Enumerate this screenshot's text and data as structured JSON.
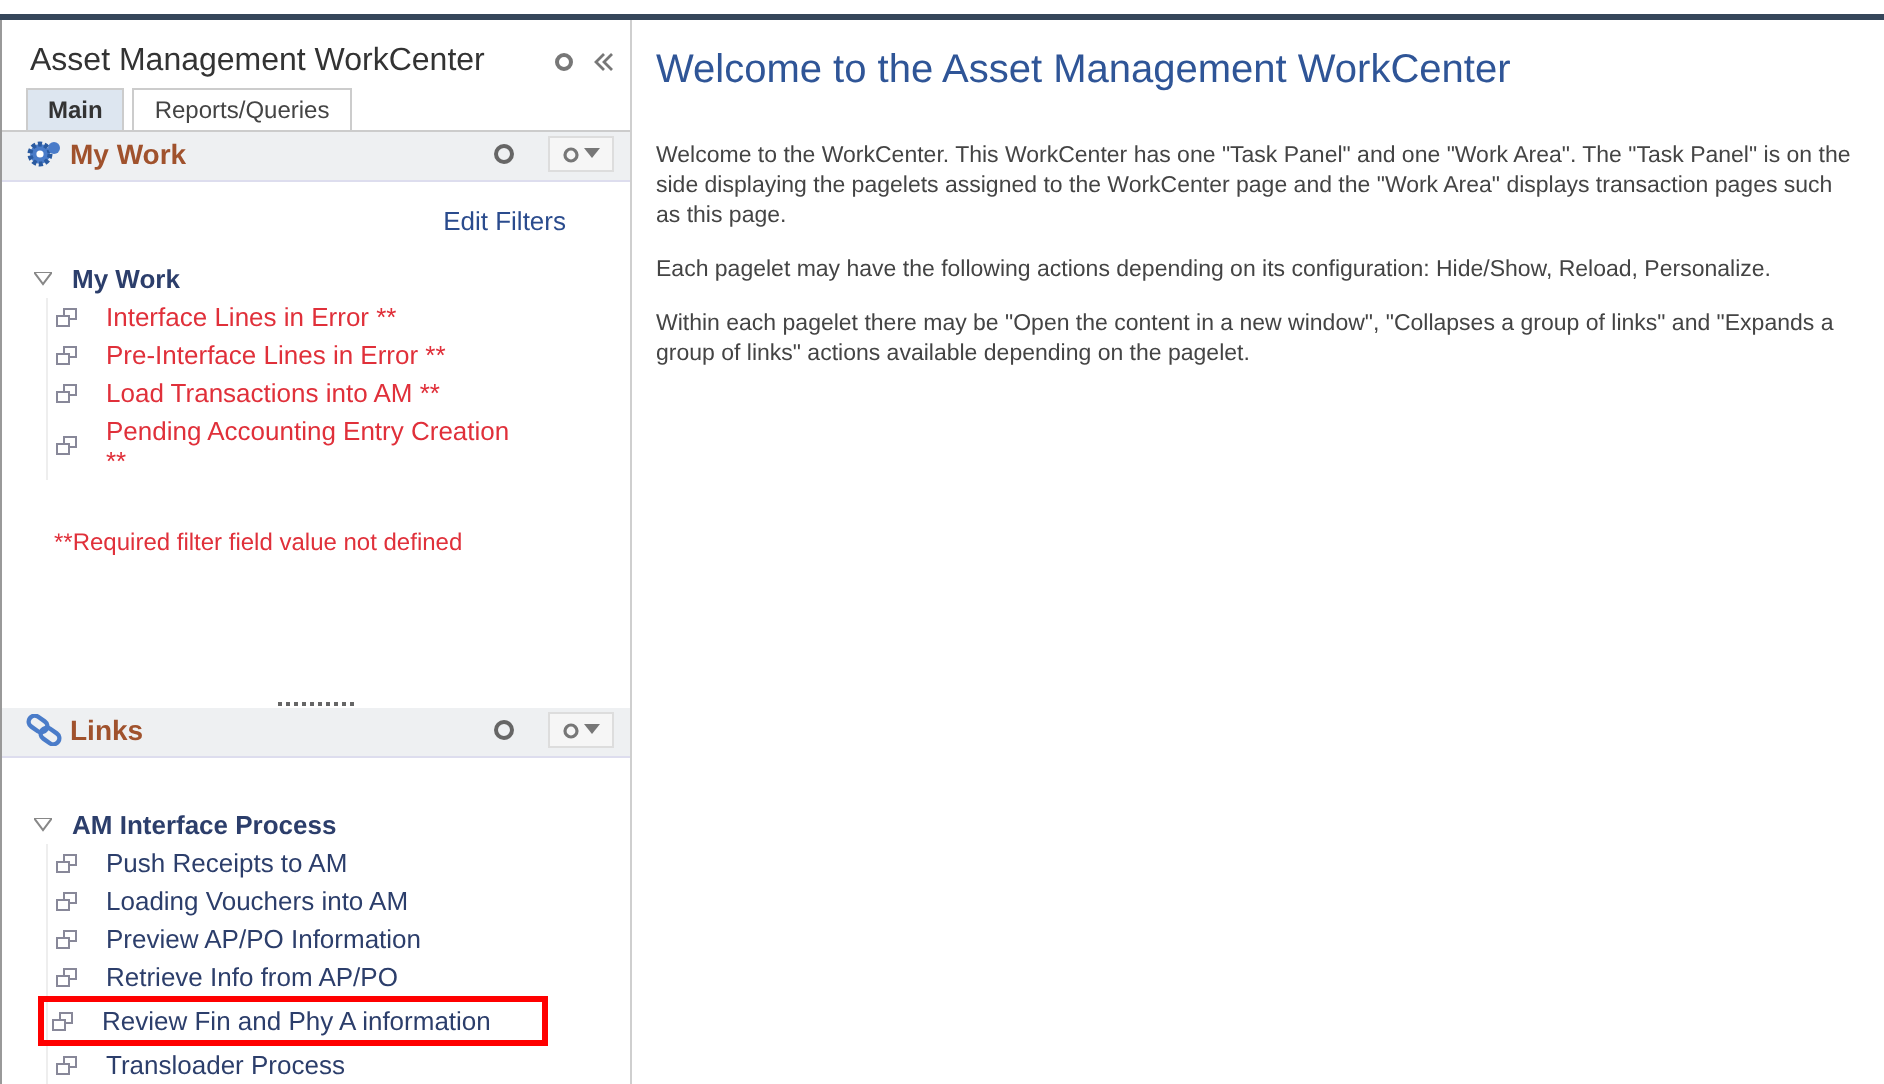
{
  "sidebar": {
    "title": "Asset Management WorkCenter",
    "tabs": [
      {
        "label": "Main",
        "selected": true
      },
      {
        "label": "Reports/Queries",
        "selected": false
      }
    ],
    "pagelets": [
      {
        "kind": "work",
        "title": "My Work",
        "edit_filters": "Edit Filters",
        "group": {
          "label": "My Work",
          "expanded": true,
          "items": [
            {
              "label": "Interface Lines in Error **"
            },
            {
              "label": "Pre-Interface Lines in Error **"
            },
            {
              "label": "Load Transactions into AM **"
            },
            {
              "label": "Pending Accounting Entry Creation **"
            }
          ]
        },
        "note": "**Required filter field value not defined"
      },
      {
        "kind": "links",
        "title": "Links",
        "group": {
          "label": "AM Interface Process",
          "expanded": true,
          "items": [
            {
              "label": "Push Receipts to AM",
              "highlighted": false
            },
            {
              "label": "Loading Vouchers into AM",
              "highlighted": false
            },
            {
              "label": "Preview AP/PO Information",
              "highlighted": false
            },
            {
              "label": "Retrieve Info from AP/PO",
              "highlighted": false
            },
            {
              "label": "Review Fin and Phy A information",
              "highlighted": true
            },
            {
              "label": "Transloader Process",
              "highlighted": false
            }
          ]
        }
      }
    ]
  },
  "main": {
    "heading": "Welcome to the Asset Management WorkCenter",
    "paragraphs": [
      "Welcome to the WorkCenter. This WorkCenter has one \"Task Panel\" and one \"Work Area\". The \"Task Panel\" is on the side displaying the pagelets assigned to the WorkCenter page and the \"Work Area\" displays transaction pages such as this page.",
      "Each pagelet may have the following actions depending on its configuration: Hide/Show, Reload, Personalize.",
      "Within each pagelet there may be \"Open the content in a new window\", \"Collapses a group of links\" and \"Expands a group of links\" actions available depending on the pagelet."
    ]
  }
}
